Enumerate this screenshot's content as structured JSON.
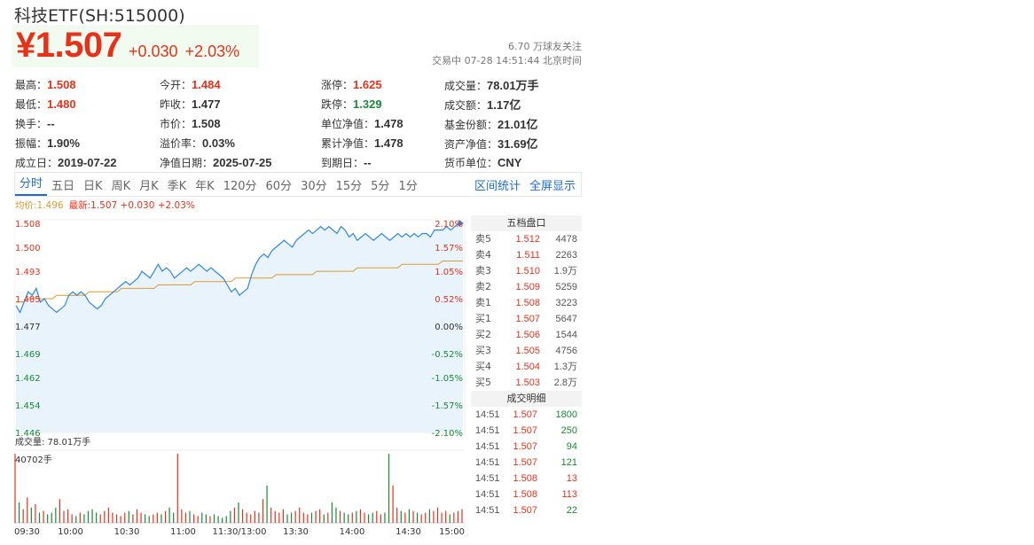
{
  "title": "科技ETF(SH:515000)",
  "price": "¥1.507",
  "change": "+0.030",
  "change_pct": "+2.03%",
  "followers": "6.70 万球友关注",
  "status": "交易中 07-28 14:51:44 北京时间",
  "quote": {
    "rows": [
      [
        {
          "k": "最高：",
          "v": "1.508",
          "c": "red"
        },
        {
          "k": "今开：",
          "v": "1.484",
          "c": "red"
        },
        {
          "k": "涨停：",
          "v": "1.625",
          "c": "red"
        },
        {
          "k": "成交量：",
          "v": "78.01万手",
          "c": ""
        }
      ],
      [
        {
          "k": "最低：",
          "v": "1.480",
          "c": "red"
        },
        {
          "k": "昨收：",
          "v": "1.477",
          "c": ""
        },
        {
          "k": "跌停：",
          "v": "1.329",
          "c": "green"
        },
        {
          "k": "成交额：",
          "v": "1.17亿",
          "c": ""
        }
      ],
      [
        {
          "k": "换手：",
          "v": "--",
          "c": ""
        },
        {
          "k": "市价：",
          "v": "1.508",
          "c": ""
        },
        {
          "k": "单位净值：",
          "v": "1.478",
          "c": ""
        },
        {
          "k": "基金份额：",
          "v": "21.01亿",
          "c": ""
        }
      ],
      [
        {
          "k": "振幅：",
          "v": "1.90%",
          "c": ""
        },
        {
          "k": "溢价率：",
          "v": "0.03%",
          "c": ""
        },
        {
          "k": "累计净值：",
          "v": "1.478",
          "c": ""
        },
        {
          "k": "资产净值：",
          "v": "31.69亿",
          "c": ""
        }
      ],
      [
        {
          "k": "成立日：",
          "v": "2019-07-22",
          "c": ""
        },
        {
          "k": "净值日期：",
          "v": "2025-07-25",
          "c": ""
        },
        {
          "k": "到期日：",
          "v": "--",
          "c": ""
        },
        {
          "k": "货币单位：",
          "v": "CNY",
          "c": ""
        }
      ]
    ]
  },
  "tabs": [
    "分时",
    "五日",
    "日K",
    "周K",
    "月K",
    "季K",
    "年K",
    "120分",
    "60分",
    "30分",
    "15分",
    "5分",
    "1分"
  ],
  "tab_active": 0,
  "tab_links": [
    "区间统计",
    "全屏显示"
  ],
  "legend": {
    "avg": "均价:1.496",
    "last": "最新:1.507 +0.030 +2.03%"
  },
  "volume_label": "成交量: 78.01万手",
  "volume_max_label": "40702手",
  "colors": {
    "up": "#e8311a",
    "down": "#1a8a34",
    "line": "#2e86de",
    "avg": "#e09a2b",
    "fill": "#e8f3fc"
  },
  "chart_data": {
    "type": "line",
    "prev_close": 1.477,
    "y_ticks_left": [
      "1.508",
      "1.500",
      "1.493",
      "1.485",
      "1.477",
      "1.469",
      "1.462",
      "1.454",
      "1.446"
    ],
    "y_ticks_right": [
      "2.10%",
      "1.57%",
      "1.05%",
      "0.52%",
      "0.00%",
      "-0.52%",
      "-1.05%",
      "-1.57%",
      "-2.10%"
    ],
    "x_ticks": [
      "09:30",
      "10:00",
      "10:30",
      "11:00",
      "11:30/13:00",
      "13:30",
      "14:00",
      "14:30",
      "15:00"
    ],
    "price_series": [
      1.483,
      1.481,
      1.484,
      1.487,
      1.486,
      1.488,
      1.484,
      1.485,
      1.483,
      1.482,
      1.481,
      1.482,
      1.483,
      1.486,
      1.487,
      1.486,
      1.487,
      1.486,
      1.484,
      1.483,
      1.482,
      1.483,
      1.485,
      1.486,
      1.487,
      1.488,
      1.489,
      1.49,
      1.489,
      1.49,
      1.491,
      1.493,
      1.492,
      1.491,
      1.493,
      1.495,
      1.493,
      1.494,
      1.493,
      1.491,
      1.492,
      1.493,
      1.494,
      1.493,
      1.494,
      1.495,
      1.494,
      1.493,
      1.494,
      1.493,
      1.492,
      1.491,
      1.489,
      1.487,
      1.488,
      1.486,
      1.487,
      1.488,
      1.492,
      1.495,
      1.497,
      1.498,
      1.497,
      1.499,
      1.5,
      1.501,
      1.502,
      1.501,
      1.5,
      1.502,
      1.503,
      1.504,
      1.505,
      1.504,
      1.505,
      1.506,
      1.505,
      1.506,
      1.505,
      1.504,
      1.506,
      1.505,
      1.503,
      1.504,
      1.502,
      1.503,
      1.504,
      1.503,
      1.502,
      1.503,
      1.504,
      1.503,
      1.502,
      1.503,
      1.504,
      1.503,
      1.504,
      1.503,
      1.504,
      1.503,
      1.504,
      1.504,
      1.503,
      1.505,
      1.505,
      1.505,
      1.506,
      1.505,
      1.506,
      1.507,
      1.507
    ],
    "avg_series_start": 1.484,
    "avg_series_end": 1.496,
    "volume_series": [
      40702,
      12000,
      8000,
      15000,
      9000,
      11000,
      6000,
      7000,
      5000,
      6000,
      9000,
      14000,
      7000,
      8000,
      5000,
      4000,
      6000,
      5000,
      7000,
      8000,
      6000,
      5000,
      7000,
      9000,
      6000,
      5000,
      4000,
      6000,
      7000,
      5000,
      8000,
      6000,
      5000,
      4000,
      5000,
      6000,
      5000,
      7000,
      9000,
      6000,
      40702,
      8000,
      6000,
      7000,
      5000,
      4000,
      6000,
      5000,
      4000,
      5000,
      4000,
      3000,
      4000,
      7000,
      9000,
      12000,
      8000,
      6000,
      5000,
      7000,
      6000,
      14000,
      22000,
      9000,
      7000,
      6000,
      8000,
      5000,
      6000,
      7000,
      9000,
      6000,
      5000,
      6000,
      7000,
      8000,
      5000,
      6000,
      12000,
      9000,
      7000,
      6000,
      5000,
      6000,
      7000,
      8000,
      6000,
      5000,
      6000,
      7000,
      5000,
      6000,
      40702,
      22000,
      9000,
      7000,
      6000,
      8000,
      7000,
      6000,
      5000,
      6000,
      8000,
      7000,
      9000,
      6000,
      7000,
      5000,
      6000,
      7000,
      8000
    ]
  },
  "order_book": {
    "header": "五档盘口",
    "asks": [
      {
        "label": "卖5",
        "price": "1.512",
        "vol": "4478"
      },
      {
        "label": "卖4",
        "price": "1.511",
        "vol": "2263"
      },
      {
        "label": "卖3",
        "price": "1.510",
        "vol": "1.9万"
      },
      {
        "label": "卖2",
        "price": "1.509",
        "vol": "5259"
      },
      {
        "label": "卖1",
        "price": "1.508",
        "vol": "3223"
      }
    ],
    "bids": [
      {
        "label": "买1",
        "price": "1.507",
        "vol": "5647"
      },
      {
        "label": "买2",
        "price": "1.506",
        "vol": "1544"
      },
      {
        "label": "买3",
        "price": "1.505",
        "vol": "4756"
      },
      {
        "label": "买4",
        "price": "1.504",
        "vol": "1.3万"
      },
      {
        "label": "买5",
        "price": "1.503",
        "vol": "2.8万"
      }
    ]
  },
  "trades": {
    "header": "成交明细",
    "rows": [
      {
        "time": "14:51",
        "price": "1.507",
        "vol": "1800",
        "dir": "up"
      },
      {
        "time": "14:51",
        "price": "1.507",
        "vol": "250",
        "dir": "up"
      },
      {
        "time": "14:51",
        "price": "1.507",
        "vol": "94",
        "dir": "up"
      },
      {
        "time": "14:51",
        "price": "1.507",
        "vol": "121",
        "dir": "up"
      },
      {
        "time": "14:51",
        "price": "1.508",
        "vol": "13",
        "dir": "down"
      },
      {
        "time": "14:51",
        "price": "1.508",
        "vol": "113",
        "dir": "down"
      },
      {
        "time": "14:51",
        "price": "1.507",
        "vol": "22",
        "dir": "up"
      }
    ]
  }
}
